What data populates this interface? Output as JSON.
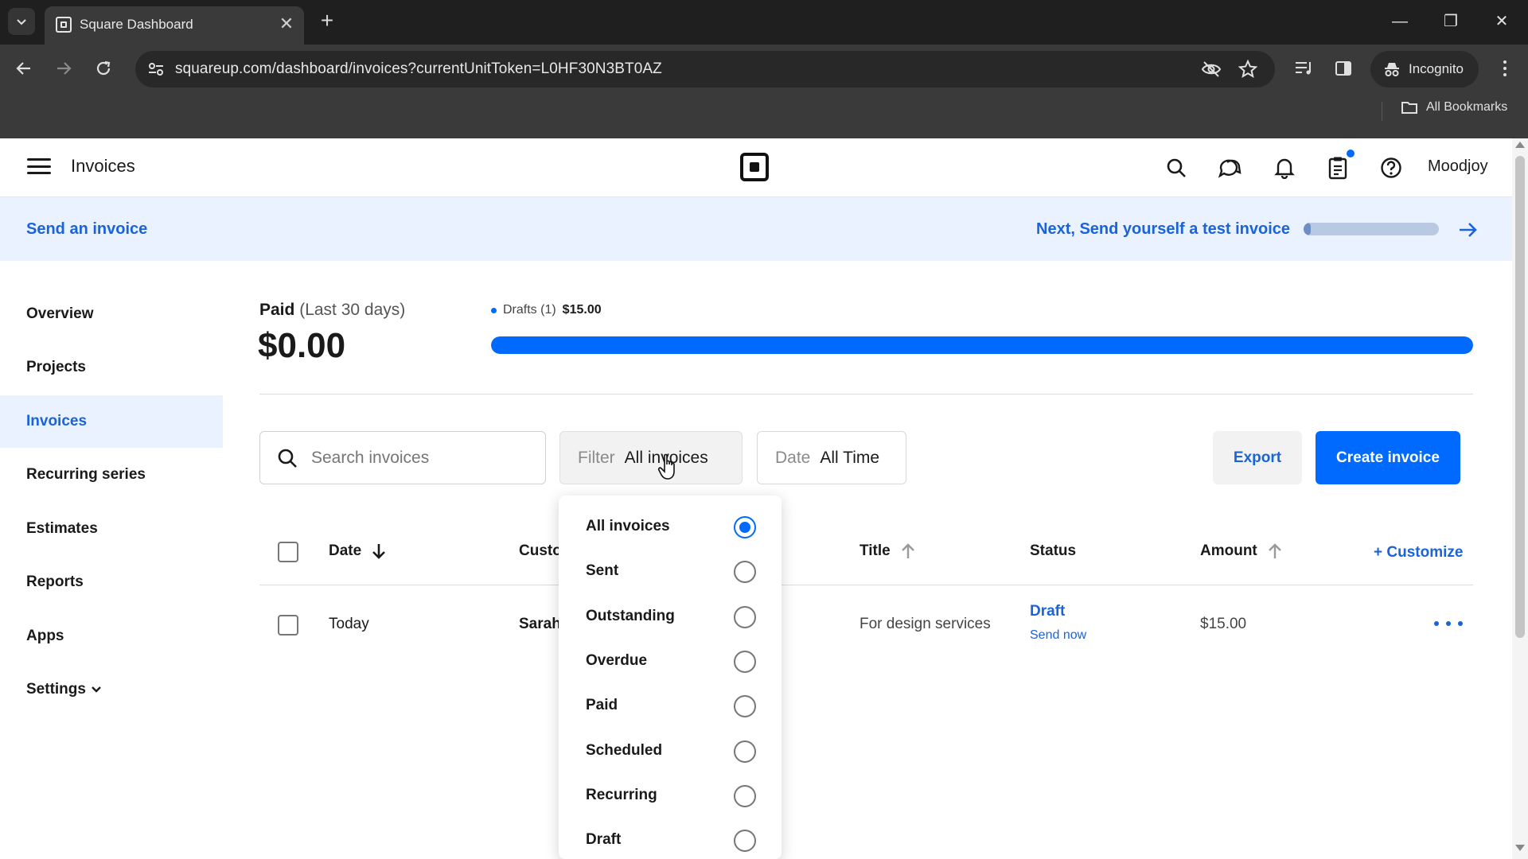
{
  "browser": {
    "tab_title": "Square Dashboard",
    "tab_close": "✕",
    "new_tab": "+",
    "url": "squareup.com/dashboard/invoices?currentUnitToken=L0HF30N3BT0AZ",
    "incognito_label": "Incognito",
    "all_bookmarks": "All Bookmarks",
    "window": {
      "minimize": "—",
      "restore": "❐",
      "close": "✕"
    }
  },
  "header": {
    "title": "Invoices",
    "account": "Moodjoy",
    "accent": "#006aff"
  },
  "banner": {
    "left_link": "Send an invoice",
    "right_link": "Next, Send yourself a test invoice",
    "progress_fraction": 0.05
  },
  "sidebar": {
    "items": [
      {
        "label": "Overview"
      },
      {
        "label": "Projects"
      },
      {
        "label": "Invoices",
        "active": true
      },
      {
        "label": "Recurring series"
      },
      {
        "label": "Estimates"
      },
      {
        "label": "Reports"
      },
      {
        "label": "Apps"
      },
      {
        "label": "Settings"
      }
    ],
    "settings_chevron": "⌄"
  },
  "summary": {
    "paid_label": "Paid",
    "paid_period": "(Last 30 days)",
    "paid_amount": "$0.00",
    "drafts_label": "Drafts (1)",
    "drafts_amount": "$15.00",
    "drafts_fraction": 1.0
  },
  "toolbar": {
    "search_placeholder": "Search invoices",
    "filter_label": "Filter",
    "filter_value": "All invoices",
    "date_label": "Date",
    "date_value": "All Time",
    "export_label": "Export",
    "create_label": "Create invoice"
  },
  "table": {
    "columns": {
      "date": "Date",
      "customer": "Custo",
      "title": "Title",
      "status": "Status",
      "amount": "Amount",
      "customize": "+ Customize"
    },
    "rows": [
      {
        "date": "Today",
        "customer": "Sarah",
        "title": "For design services",
        "status": "Draft",
        "status_action": "Send now",
        "amount": "$15.00"
      }
    ]
  },
  "filter_menu": {
    "options": [
      {
        "label": "All invoices",
        "selected": true
      },
      {
        "label": "Sent"
      },
      {
        "label": "Outstanding"
      },
      {
        "label": "Overdue"
      },
      {
        "label": "Paid"
      },
      {
        "label": "Scheduled"
      },
      {
        "label": "Recurring"
      },
      {
        "label": "Draft"
      }
    ]
  }
}
